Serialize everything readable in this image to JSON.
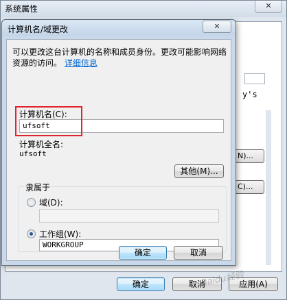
{
  "background_window": {
    "title": "系统属性",
    "close_glyph": "✕",
    "text_fragment": "y's",
    "btn_fragment_1": "N)...",
    "btn_fragment_2": "C)...",
    "ok": "确定",
    "cancel": "取消",
    "apply": "应用(A)"
  },
  "dialog": {
    "title": "计算机名/域更改",
    "close_glyph": "✕",
    "description": "可以更改这台计算机的名称和成员身份。更改可能影响网络资源的访问。",
    "details_link": "详细信息",
    "computer_name_label": "计算机名(C):",
    "computer_name_value": "ufsoft",
    "full_name_label": "计算机全名:",
    "full_name_value": "ufsoft",
    "more_button": "其他(M)...",
    "member_of_label": "隶属于",
    "domain_label": "域(D):",
    "domain_value": "",
    "workgroup_label": "工作组(W):",
    "workgroup_value": "WORKGROUP",
    "ok": "确定",
    "cancel": "取消"
  },
  "watermark": "Baidu经验"
}
